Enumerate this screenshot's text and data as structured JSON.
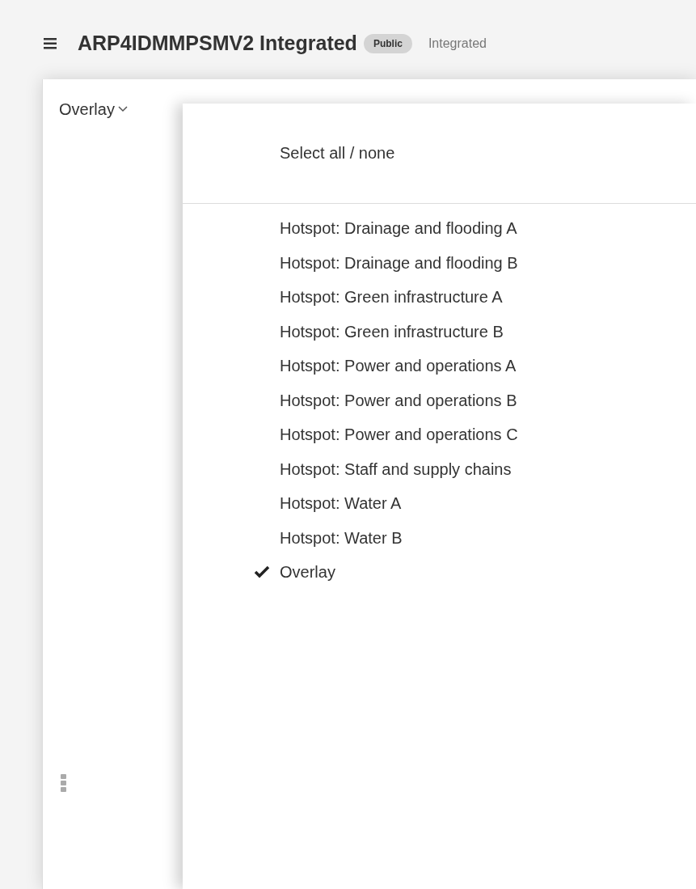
{
  "header": {
    "title": "ARP4IDMMPSMV2 Integrated",
    "badge": "Public",
    "subtitle": "Integrated"
  },
  "panel": {
    "dropdown_label": "Overlay"
  },
  "menu": {
    "select_all": "Select all / none",
    "items": [
      {
        "label": "Hotspot: Drainage and flooding A",
        "checked": false
      },
      {
        "label": "Hotspot: Drainage and flooding B",
        "checked": false
      },
      {
        "label": "Hotspot: Green infrastructure A",
        "checked": false
      },
      {
        "label": "Hotspot: Green infrastructure B",
        "checked": false
      },
      {
        "label": "Hotspot: Power and operations A",
        "checked": false
      },
      {
        "label": "Hotspot: Power and operations B",
        "checked": false
      },
      {
        "label": "Hotspot: Power and operations C",
        "checked": false
      },
      {
        "label": "Hotspot: Staff and supply chains",
        "checked": false
      },
      {
        "label": "Hotspot: Water A",
        "checked": false
      },
      {
        "label": "Hotspot: Water B",
        "checked": false
      },
      {
        "label": "Overlay",
        "checked": true
      }
    ]
  }
}
